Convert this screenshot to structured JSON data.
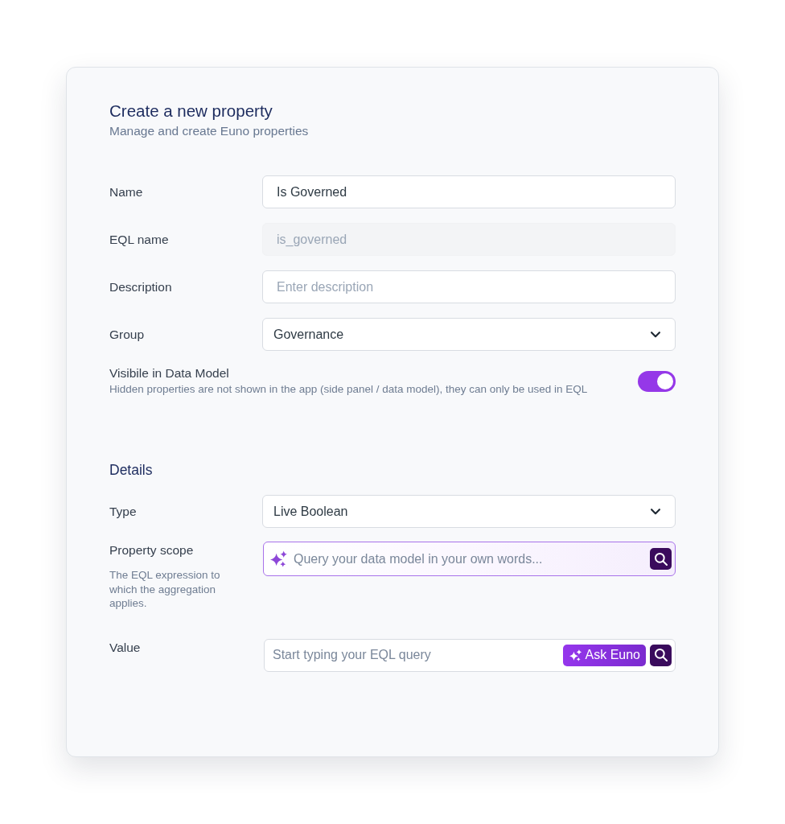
{
  "header": {
    "title": "Create a new property",
    "subtitle": "Manage and create Euno properties"
  },
  "fields": [
    {
      "kind": "text",
      "label": "Name",
      "value": "Is Governed",
      "disabled": false
    },
    {
      "kind": "text",
      "label": "EQL name",
      "value": "is_governed",
      "disabled": true
    },
    {
      "kind": "text",
      "label": "Description",
      "placeholder": "Enter description",
      "disabled": false
    },
    {
      "kind": "select",
      "label": "Group",
      "value": "Governance",
      "disabled": false
    }
  ],
  "visibility": {
    "label": "Visibile in Data Model",
    "hint": "Hidden properties are not shown in the app (side panel / data model), they can only be used in EQL",
    "on": true
  },
  "details": {
    "title": "Details",
    "fields": [
      {
        "kind": "select",
        "label": "Type",
        "value": "Live Boolean"
      },
      {
        "kind": "ai-query",
        "label": "Property scope",
        "help": "The EQL expression to which the aggregation applies.",
        "placeholder": "Query your data model in your own words..."
      },
      {
        "kind": "eql-query",
        "label": "Value",
        "placeholder": "Start typing your EQL query",
        "ask_button": "Ask Euno"
      }
    ]
  }
}
